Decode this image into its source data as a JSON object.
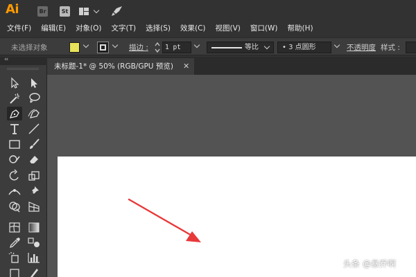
{
  "app": {
    "logo": "Ai",
    "bridge_label": "Br",
    "stock_label": "St"
  },
  "menu": [
    "文件(F)",
    "编辑(E)",
    "对象(O)",
    "文字(T)",
    "选择(S)",
    "效果(C)",
    "视图(V)",
    "窗口(W)",
    "帮助(H)"
  ],
  "control": {
    "selection_status": "未选择对象",
    "stroke_label": "描边 :",
    "stroke_weight": "1 pt",
    "stroke_profile": "等比",
    "brush": "•  3 点圆形",
    "opacity_label": "不透明度",
    "style_label": "样式 :"
  },
  "document": {
    "tab_title": "未标题-1* @ 50% (RGB/GPU 预览)",
    "close_glyph": "✕"
  },
  "watermark": "头条 @悬乔啊",
  "colors": {
    "fill": "#e7e35a",
    "annotation_arrow": "#e8393a",
    "brand": "#ff9a00"
  }
}
